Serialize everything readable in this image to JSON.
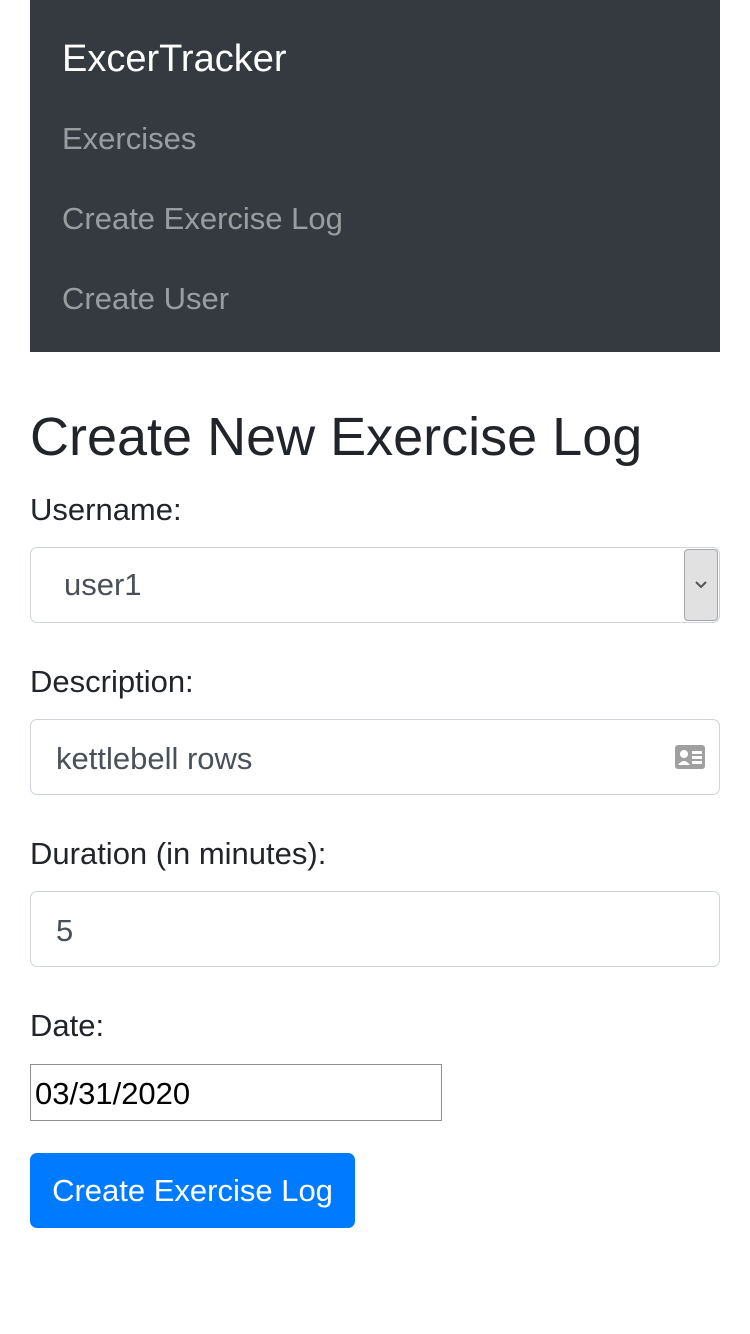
{
  "navbar": {
    "brand": "ExcerTracker",
    "links": [
      {
        "label": "Exercises"
      },
      {
        "label": "Create Exercise Log"
      },
      {
        "label": "Create User"
      }
    ],
    "background_color": "#343a40"
  },
  "form": {
    "title": "Create New Exercise Log",
    "username": {
      "label": "Username:",
      "selected": "user1",
      "arrow_icon": "chevron-down-icon"
    },
    "description": {
      "label": "Description:",
      "value": "kettlebell rows",
      "icon": "contact-card-icon"
    },
    "duration": {
      "label": "Duration (in minutes):",
      "value": "5"
    },
    "date": {
      "label": "Date:",
      "value": "03/31/2020"
    },
    "submit_label": "Create Exercise Log"
  },
  "colors": {
    "primary": "#007bff",
    "text": "#212529",
    "nav_link": "rgba(255,255,255,0.5)"
  }
}
